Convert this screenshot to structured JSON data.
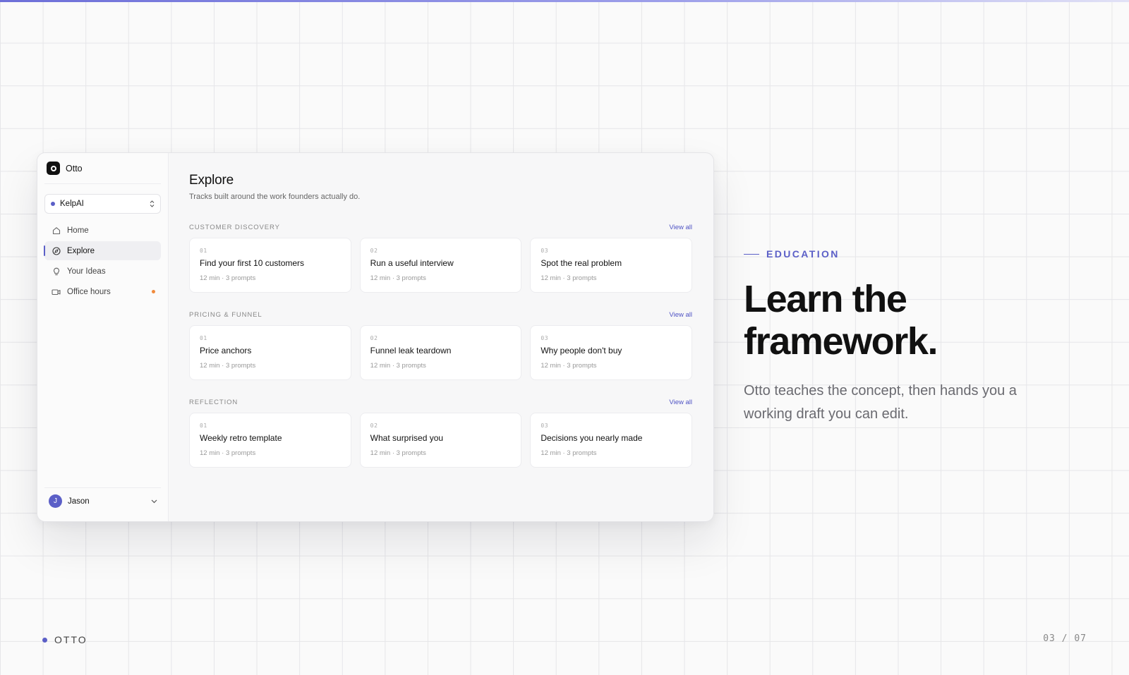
{
  "app": {
    "brand_name": "Otto",
    "workspace": {
      "name": "KelpAI"
    },
    "nav": [
      {
        "label": "Home",
        "icon": "home-icon"
      },
      {
        "label": "Explore",
        "icon": "compass-icon",
        "active": true
      },
      {
        "label": "Your Ideas",
        "icon": "lightbulb-icon"
      },
      {
        "label": "Office hours",
        "icon": "video-icon",
        "badge": true
      }
    ],
    "user": {
      "initial": "J",
      "name": "Jason"
    }
  },
  "main": {
    "title": "Explore",
    "subtitle": "Tracks built around the work founders actually do.",
    "sections": [
      {
        "title": "CUSTOMER DISCOVERY",
        "view_all": "View all",
        "cards": [
          {
            "num": "01",
            "title": "Find your first 10 customers",
            "meta": "12 min · 3 prompts"
          },
          {
            "num": "02",
            "title": "Run a useful interview",
            "meta": "12 min · 3 prompts"
          },
          {
            "num": "03",
            "title": "Spot the real problem",
            "meta": "12 min · 3 prompts"
          }
        ]
      },
      {
        "title": "PRICING & FUNNEL",
        "view_all": "View all",
        "cards": [
          {
            "num": "01",
            "title": "Price anchors",
            "meta": "12 min · 3 prompts"
          },
          {
            "num": "02",
            "title": "Funnel leak teardown",
            "meta": "12 min · 3 prompts"
          },
          {
            "num": "03",
            "title": "Why people don't buy",
            "meta": "12 min · 3 prompts"
          }
        ]
      },
      {
        "title": "REFLECTION",
        "view_all": "View all",
        "cards": [
          {
            "num": "01",
            "title": "Weekly retro template",
            "meta": "12 min · 3 prompts"
          },
          {
            "num": "02",
            "title": "What surprised you",
            "meta": "12 min · 3 prompts"
          },
          {
            "num": "03",
            "title": "Decisions you nearly made",
            "meta": "12 min · 3 prompts"
          }
        ]
      }
    ]
  },
  "hero": {
    "eyebrow": "EDUCATION",
    "title_line1": "Learn the",
    "title_line2": "framework.",
    "body": "Otto teaches the concept, then hands you a working draft you can edit."
  },
  "footer": {
    "brand": "OTTO",
    "pager": "03 / 07"
  },
  "colors": {
    "accent": "#5b5fc7",
    "badge": "#f08a3c",
    "text": "#111111"
  }
}
